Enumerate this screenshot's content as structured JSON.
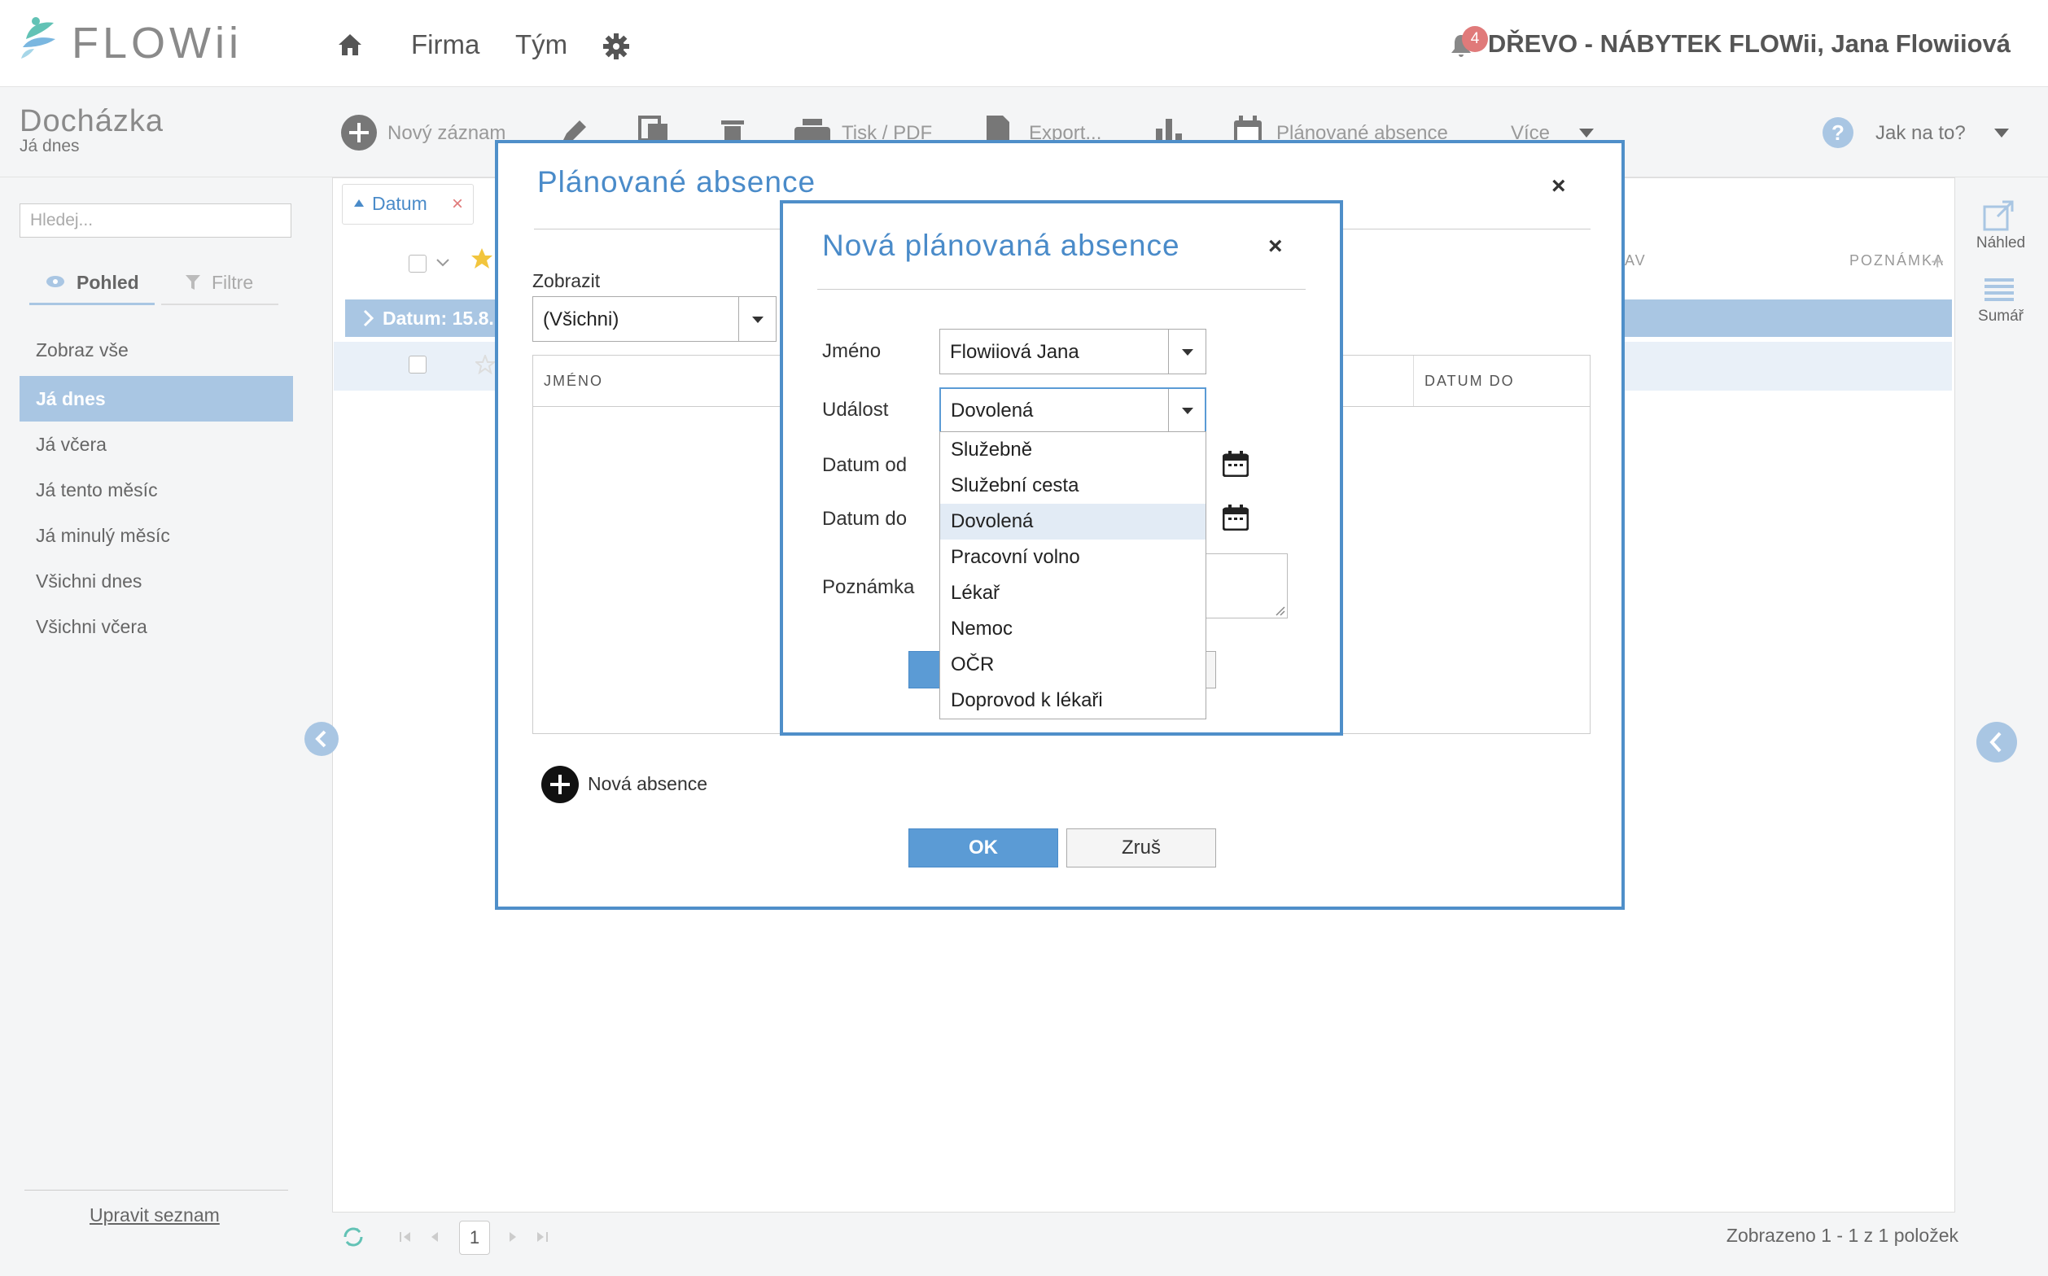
{
  "header": {
    "logo_text": "FLOWii",
    "nav": [
      "Firma",
      "Tým"
    ],
    "notification_count": "4",
    "user_text": "DŘEVO - NÁBYTEK FLOWii, Jana Flowiiová"
  },
  "page": {
    "title": "Docházka",
    "subtitle": "Já dnes"
  },
  "toolbar": {
    "new_record": "Nový záznam",
    "print": "Tisk / PDF",
    "export": "Export...",
    "planned_absences": "Plánované absence",
    "more": "Více",
    "help": "Jak na to?"
  },
  "sidebar": {
    "search_placeholder": "Hledej...",
    "tabs": [
      "Pohled",
      "Filtre"
    ],
    "items": [
      {
        "label": "Zobraz vše"
      },
      {
        "label": "Já dnes"
      },
      {
        "label": "Já včera"
      },
      {
        "label": "Já tento měsíc"
      },
      {
        "label": "Já minulý měsíc"
      },
      {
        "label": "Všichni dnes"
      },
      {
        "label": "Všichni včera"
      }
    ],
    "edit_list": "Upravit seznam"
  },
  "grid": {
    "filter_chip": "Datum",
    "group_label": "Datum: 15.8.",
    "col_partial": "AV",
    "col_note": "POZNÁMKA",
    "page": "1",
    "status": "Zobrazeno 1 - 1 z 1 položek"
  },
  "right_rail": {
    "preview": "Náhled",
    "summary": "Sumář"
  },
  "dialog_planned": {
    "title": "Plánované absence",
    "show_label": "Zobrazit",
    "show_value": "(Všichni)",
    "col_name": "JMÉNO",
    "col_date_to": "DATUM DO",
    "new_absence": "Nová absence",
    "ok": "OK",
    "cancel": "Zruš"
  },
  "dialog_new": {
    "title": "Nová plánovaná absence",
    "name_label": "Jméno",
    "name_value": "Flowiiová Jana",
    "event_label": "Událost",
    "event_value": "Dovolená",
    "date_from_label": "Datum od",
    "date_to_label": "Datum do",
    "note_label": "Poznámka"
  },
  "event_options": [
    "Služebně",
    "Služební cesta",
    "Dovolená",
    "Pracovní volno",
    "Lékař",
    "Nemoc",
    "OČR",
    "Doprovod k lékaři"
  ],
  "colors": {
    "accent": "#4a8bc9",
    "dialog_border": "#4f8fc9",
    "selection": "#a9c6e3",
    "badge": "#e07a7a"
  }
}
